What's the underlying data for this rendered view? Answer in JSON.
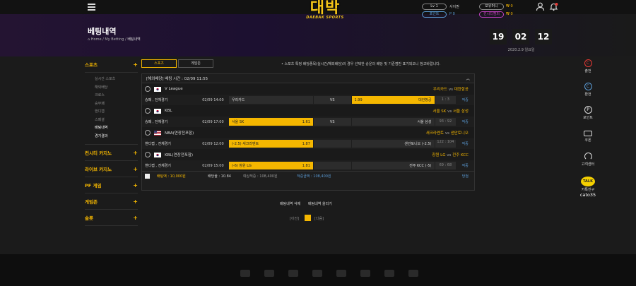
{
  "header": {
    "logo_main": "대박",
    "logo_sub": "DAEBAK SPORTS",
    "level": "Lv 1",
    "username": "사이퀀",
    "points_label": "포인트",
    "points_value": "P 0",
    "money_label": "보유머니",
    "money_value": "₩ 0",
    "casino_label": "컨시티캠퍼",
    "casino_value": "₩ 0",
    "bell_badge": ""
  },
  "page": {
    "title": "베팅내역",
    "breadcrumb_home": "Home",
    "breadcrumb_mid": "My Betting",
    "breadcrumb_current": "배팅내역"
  },
  "clock": {
    "hours": "19",
    "minutes": "02",
    "seconds": "12",
    "date": "2020.2.9 일요일"
  },
  "sidebar": {
    "categories": [
      {
        "label": "스포츠",
        "expanded": true
      },
      {
        "label": "컨시티 카지노"
      },
      {
        "label": "라이브 카지노"
      },
      {
        "label": "PF 게임"
      },
      {
        "label": "게임존"
      },
      {
        "label": "슬롯"
      }
    ],
    "sports_items": [
      "실시간 스포츠",
      "해외배당",
      "크로스",
      "승무패",
      "핸디캡",
      "스페셜",
      "배팅내역",
      "경기결과"
    ],
    "active_item": "배팅내역"
  },
  "tabs": [
    {
      "label": "스포츠",
      "active": true
    },
    {
      "label": "게임존",
      "active": false
    }
  ],
  "notice": "• 스포츠 특정 배당종목(실시간/해외배당)의 경우 선택한 승운의 배당 및 기준점만 표기되오니 참고바랍니다.",
  "bet": {
    "header": "[해외배당] 배팅 시간 : 02/09 11:55",
    "games": [
      {
        "league": "V League",
        "flag": "kr",
        "sport": "volleyball",
        "home": "우리카드",
        "away": "대한항공",
        "type": "승패 , 전체경기",
        "time": "02/09 14:00",
        "left_label": "우리카드",
        "left_odds": "",
        "mid": "VS",
        "right_label": "대한항공",
        "right_odds": "1.99",
        "score": "1 : 3",
        "status": "적중",
        "selected": "right"
      },
      {
        "league": "KBL",
        "flag": "kr",
        "sport": "basketball",
        "home": "서울 SK",
        "away": "서울 삼성",
        "type": "승패 , 전체경기",
        "time": "02/09 17:00",
        "left_label": "서울 SK",
        "left_odds": "1.61",
        "mid": "VS",
        "right_label": "서울 삼성",
        "right_odds": "",
        "score": "93 : 92",
        "status": "적중",
        "selected": "left"
      },
      {
        "league": "NBA(연장전포함)",
        "flag": "us",
        "sport": "basketball",
        "home": "새크라멘토",
        "away": "샌안토니오",
        "type": "핸디캡 , 전체경기",
        "time": "02/09 12:00",
        "left_label": "(-2.5) 새크라멘토",
        "left_odds": "1.87",
        "mid": "",
        "right_label": "샌안토니오 (-2.5)",
        "right_odds": "",
        "score": "122 : 104",
        "status": "적중",
        "selected": "left"
      },
      {
        "league": "KBL(연장전포함)",
        "flag": "kr",
        "sport": "basketball",
        "home": "창원 LG",
        "away": "전주 KCC",
        "type": "핸디캡 , 전체경기",
        "time": "02/09 15:00",
        "left_label": "(-6) 창원 LG",
        "left_odds": "1.81",
        "mid": "",
        "right_label": "전주 KCC (-5)",
        "right_odds": "",
        "score": "69 : 68",
        "status": "적중",
        "selected": "left"
      }
    ],
    "summary": {
      "stake_label": "배팅액 : 10,000원",
      "odds_label": "배당율 : 10.84",
      "expected_label": "예상적중 : 108,400원",
      "won_label": "적중금액 : 108,400원",
      "result": "당첨"
    }
  },
  "actions": {
    "delete": "배팅내역 삭제",
    "clear": "배팅내역 올리기"
  },
  "pagination": {
    "prev": "[이전]",
    "next": "[다음]",
    "current": "1"
  },
  "rightbar": [
    {
      "label": "출전",
      "icon": "charge-icon"
    },
    {
      "label": "환전",
      "icon": "exchange-icon"
    },
    {
      "label": "포인트",
      "icon": "point-icon"
    },
    {
      "label": "쿠폰",
      "icon": "coupon-icon"
    },
    {
      "label": "고객센터",
      "icon": "headset-icon"
    }
  ],
  "kakao": {
    "badge": "TALK",
    "label": "카톡친구",
    "id": "cato35"
  },
  "colors": {
    "accent": "#f5b700",
    "link": "#5b9bd5",
    "bg": "#1b1b1b"
  }
}
